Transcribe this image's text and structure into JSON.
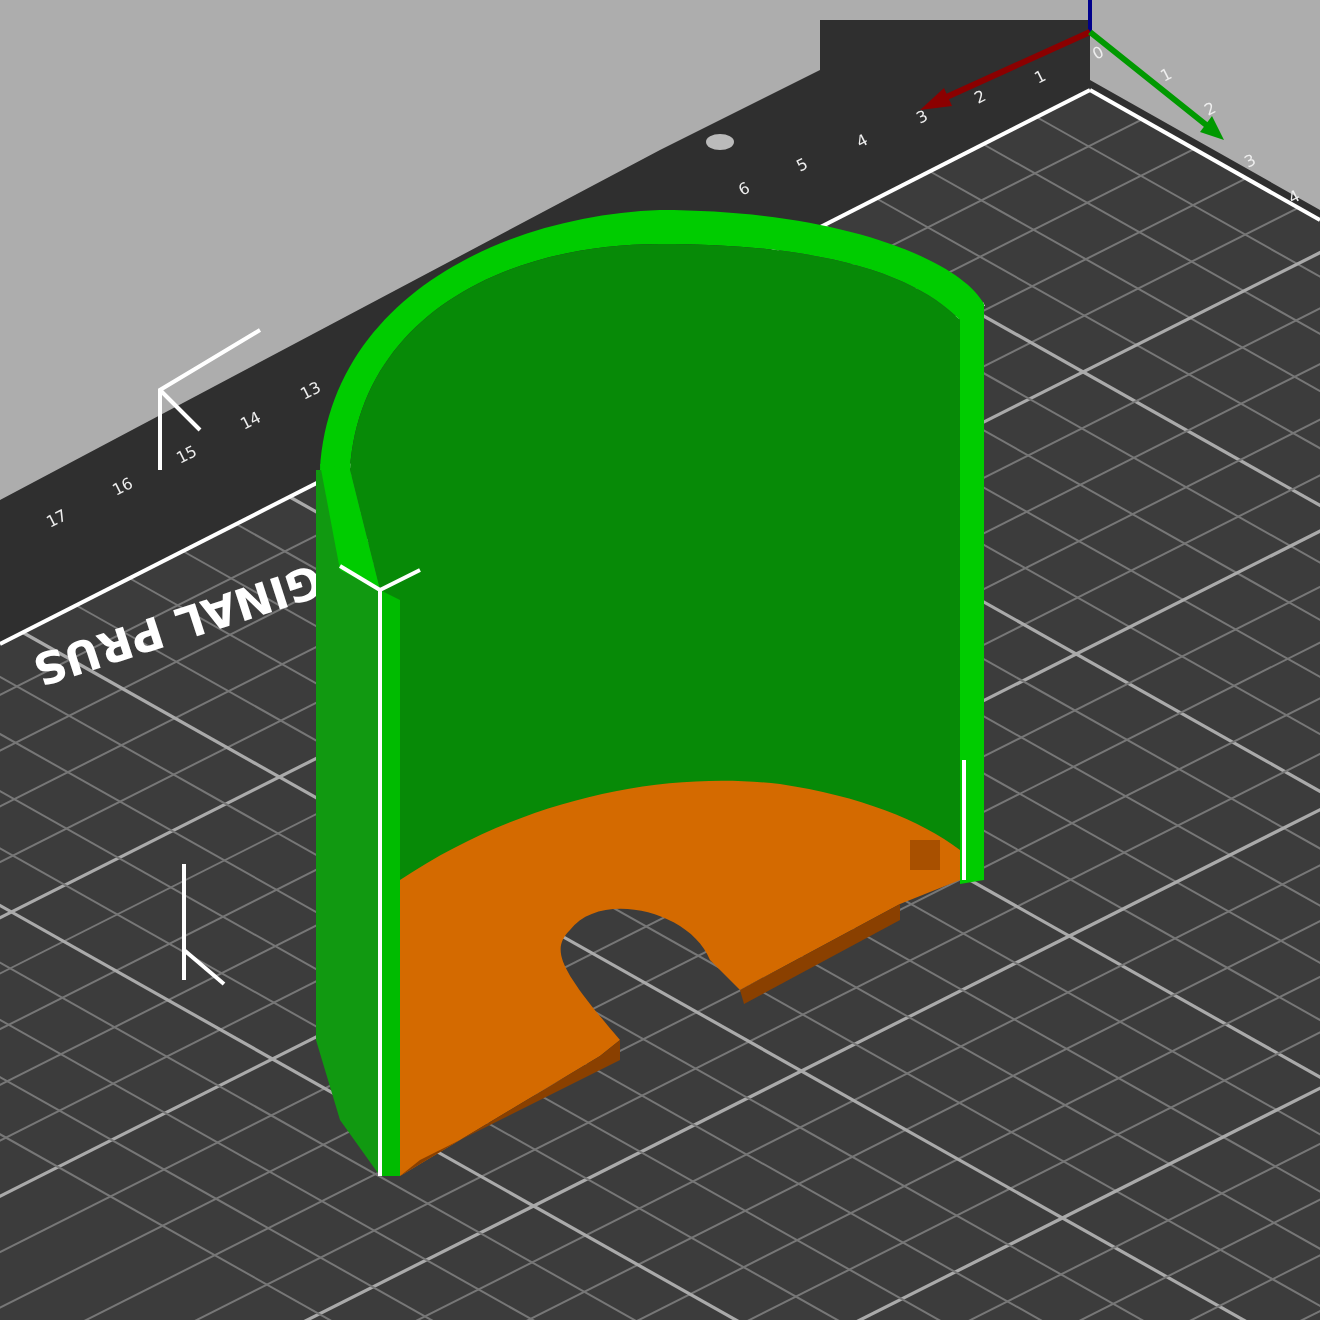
{
  "viewport": {
    "bed_label": "GINAL PRUS",
    "x_ticks": [
      "0",
      "1",
      "2",
      "3",
      "4",
      "5",
      "6"
    ],
    "left_ticks": [
      "13",
      "14",
      "15",
      "16",
      "17"
    ],
    "y_ticks": [
      "1",
      "2",
      "3",
      "4"
    ]
  }
}
